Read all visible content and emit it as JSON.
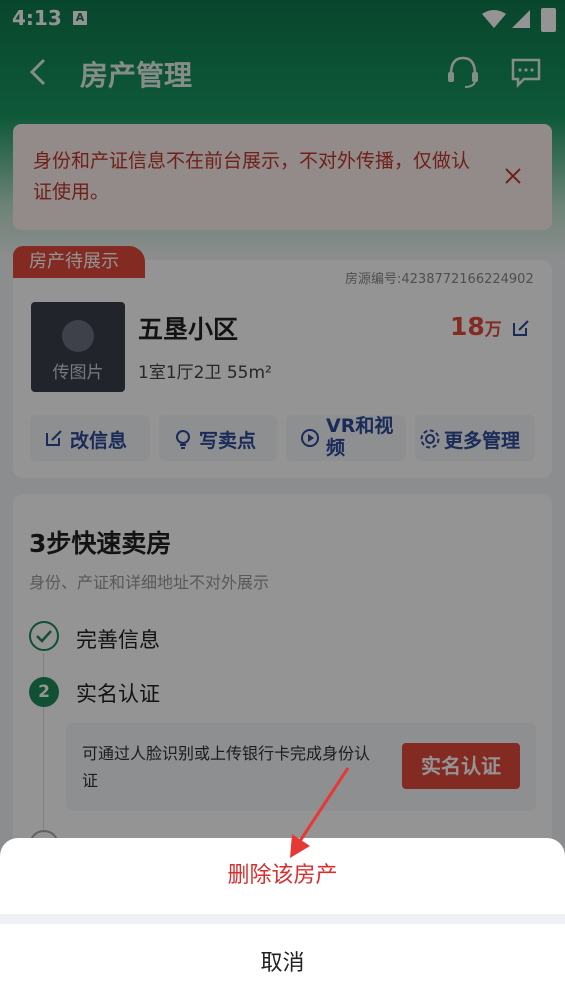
{
  "status_bar": {
    "time": "4:13",
    "app_icon_letter": "A"
  },
  "nav": {
    "title": "房产管理",
    "icons": [
      "back-icon",
      "customer-service-icon",
      "message-icon"
    ]
  },
  "notice": {
    "text": "身份和产证信息不在前台展示，不对外传播，仅做认证使用。"
  },
  "house": {
    "badge": "房产待展示",
    "listing_no": "房源编号:4238772166224902",
    "photo_caption": "传图片",
    "name": "五垦小区",
    "layout": "1室1厅2卫 55m²",
    "price_num": "18",
    "price_unit": "万"
  },
  "actions": [
    {
      "label": "改信息",
      "icon": "edit-icon"
    },
    {
      "label": "写卖点",
      "icon": "bulb-icon"
    },
    {
      "label": "VR和视频",
      "icon": "play-icon"
    },
    {
      "label": "更多管理",
      "icon": "gear-icon"
    }
  ],
  "steps": {
    "title": "3步快速卖房",
    "subtitle": "身份、产证和详细地址不对外展示",
    "step1": "完善信息",
    "step2_num": "2",
    "step2": "实名认证",
    "verify_text": "可通过人脸识别或上传银行卡完成身份认证",
    "verify_button": "实名认证"
  },
  "sheet": {
    "delete": "删除该房产",
    "cancel": "取消"
  },
  "colors": {
    "brand_green": "#1f8a5a",
    "accent_red": "#e24a3b",
    "delete_red": "#d92e2e"
  }
}
